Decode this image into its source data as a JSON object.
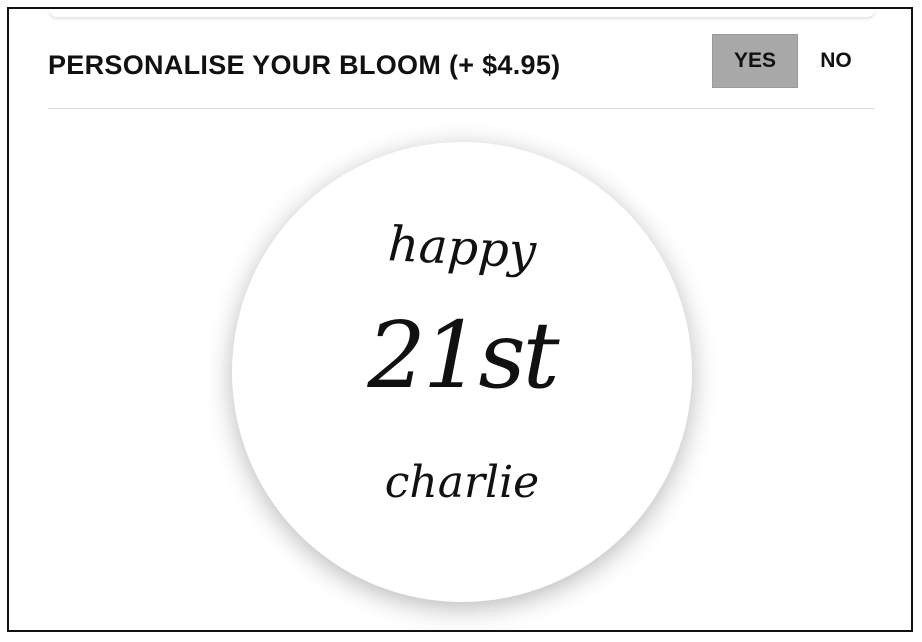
{
  "personalise": {
    "title": "PERSONALISE YOUR BLOOM (+ $4.95)",
    "options": [
      {
        "label": "YES",
        "selected": true
      },
      {
        "label": "NO",
        "selected": false
      }
    ]
  },
  "preview": {
    "line1": "happy",
    "line2": "21st",
    "line3": "charlie"
  },
  "colors": {
    "selected_option_bg": "#a8a8a8",
    "text": "#111111",
    "divider": "#d9d9d9"
  }
}
